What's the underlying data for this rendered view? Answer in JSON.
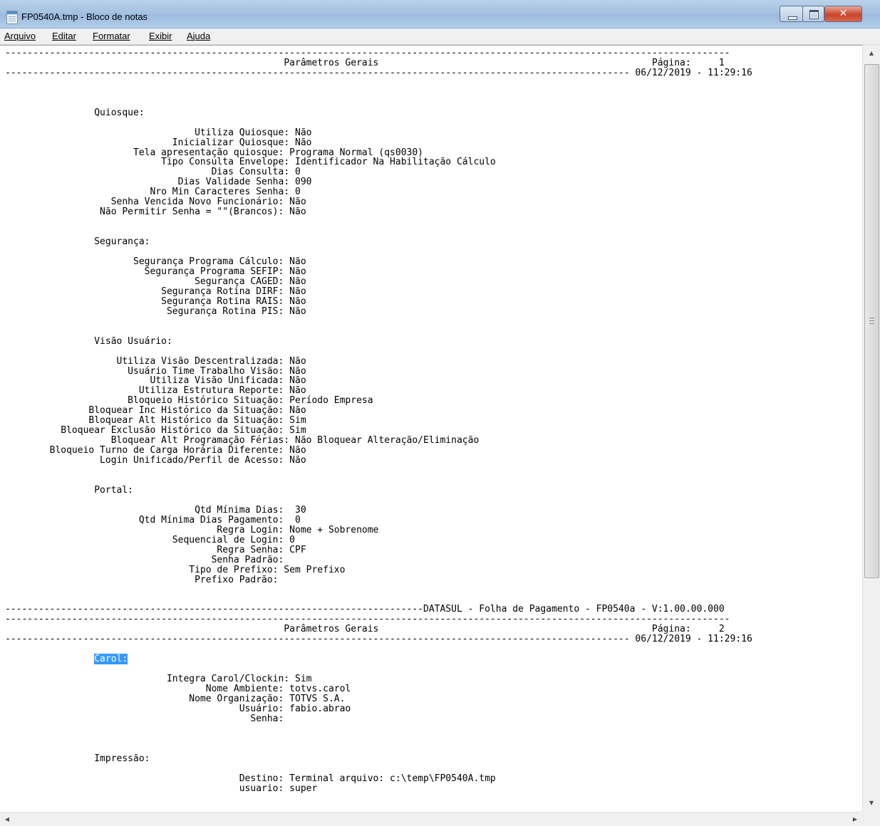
{
  "window": {
    "title": "FP0540A.tmp - Bloco de notas"
  },
  "menu": {
    "items": [
      "Arquivo",
      "Editar",
      "Formatar",
      "Exibir",
      "Ajuda"
    ]
  },
  "icons": {
    "app": "notepad-icon",
    "minimize": "minimize-icon",
    "maximize": "maximize-icon",
    "close": "close-icon",
    "scroll_up": "arrow-up-icon",
    "scroll_down": "arrow-down-icon",
    "scroll_left": "arrow-left-icon",
    "scroll_right": "arrow-right-icon"
  },
  "colors": {
    "selection": "#3399ff",
    "titlebar": "#a5c2e1",
    "close_button": "#c9452d"
  },
  "document": {
    "lines_before_selection": [
      "----------------------------------------------------------------------------------------------------------------------------------",
      "                                                  Parâmetros Gerais                                                 Página:     1",
      "---------------------------------------------------------------------------------------------------------------- 06/12/2019 - 11:29:16",
      "",
      "",
      "",
      "                Quiosque:",
      "",
      "                                  Utiliza Quiosque: Não",
      "                              Inicializar Quiosque: Não",
      "                       Tela apresentação quiosque: Programa Normal (qs0030)",
      "                            Tipo Consulta Envelope: Identificador Na Habilitação Cálculo",
      "                                     Dias Consulta: 0",
      "                               Dias Validade Senha: 090",
      "                          Nro Min Caracteres Senha: 0",
      "                   Senha Vencida Novo Funcionário: Não",
      "                 Não Permitir Senha = \"\"(Brancos): Não",
      "",
      "",
      "                Segurança:",
      "",
      "                       Segurança Programa Cálculo: Não",
      "                         Segurança Programa SEFIP: Não",
      "                                  Segurança CAGED: Não",
      "                            Segurança Rotina DIRF: Não",
      "                            Segurança Rotina RAIS: Não",
      "                             Segurança Rotina PIS: Não",
      "",
      "",
      "                Visão Usuário:",
      "",
      "                    Utiliza Visão Descentralizada: Não",
      "                      Usuário Time Trabalho Visão: Não",
      "                          Utiliza Visão Unificada: Não",
      "                        Utiliza Estrutura Reporte: Não",
      "                      Bloqueio Histórico Situação: Período Empresa",
      "               Bloquear Inc Histórico da Situação: Não",
      "               Bloquear Alt Histórico da Situação: Sim",
      "          Bloquear Exclusão Histórico da Situação: Sim",
      "                   Bloquear Alt Programação Férias: Não Bloquear Alteração/Eliminação",
      "        Bloqueio Turno de Carga Horária Diferente: Não",
      "                 Login Unificado/Perfil de Acesso: Não",
      "",
      "",
      "                Portal:",
      "",
      "                                  Qtd Mínima Dias:  30",
      "                        Qtd Mínima Dias Pagamento:  0",
      "                                      Regra Login: Nome + Sobrenome",
      "                              Sequencial de Login: 0",
      "                                      Regra Senha: CPF",
      "                                     Senha Padrão:",
      "                                 Tipo de Prefixo: Sem Prefixo",
      "                                  Prefixo Padrão:",
      "",
      "",
      "---------------------------------------------------------------------------DATASUL - Folha de Pagamento - FP0540a - V:1.00.00.000",
      "\f----------------------------------------------------------------------------------------------------------------------------------",
      "                                                  Parâmetros Gerais                                                 Página:     2",
      "---------------------------------------------------------------------------------------------------------------- 06/12/2019 - 11:29:16",
      ""
    ],
    "selection_indent": "                ",
    "selected_text": "Carol:",
    "lines_after_selection": [
      "",
      "                             Integra Carol/Clockin: Sim",
      "                                    Nome Ambiente: totvs.carol",
      "                                 Nome Organização: TOTVS S.A.",
      "                                          Usuário: fabio.abrao",
      "                                            Senha:",
      "",
      "",
      "",
      "                Impressão:",
      "",
      "                                          Destino: Terminal arquivo: c:\\temp\\FP0540A.tmp",
      "                                          usuario: super"
    ]
  }
}
